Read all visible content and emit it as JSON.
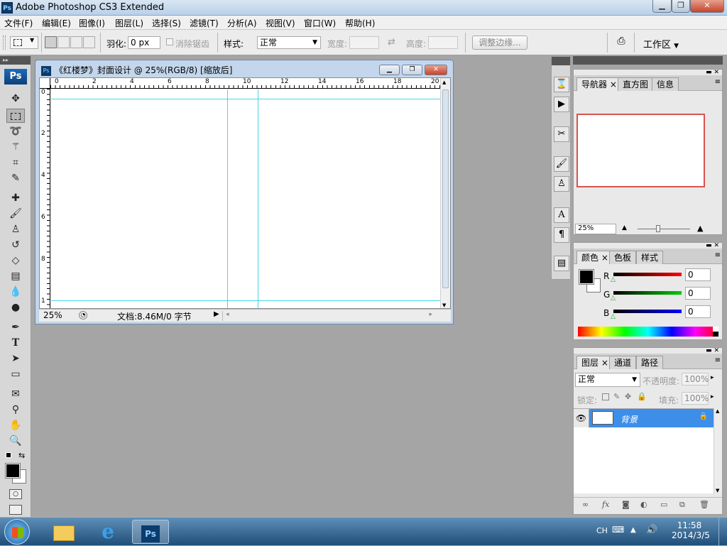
{
  "window": {
    "title": "Adobe Photoshop CS3 Extended",
    "badge": "Ps",
    "min": "▁",
    "max": "❐",
    "close": "✕"
  },
  "menu": [
    "文件(F)",
    "编辑(E)",
    "图像(I)",
    "图层(L)",
    "选择(S)",
    "滤镜(T)",
    "分析(A)",
    "视图(V)",
    "窗口(W)",
    "帮助(H)"
  ],
  "options": {
    "feather_label": "羽化:",
    "feather_value": "0 px",
    "antialias_label": "消除锯齿",
    "style_label": "样式:",
    "style_value": "正常",
    "width_label": "宽度:",
    "height_label": "高度:",
    "refine_edge": "调整边缘...",
    "workspace": "工作区"
  },
  "toolbox": {
    "logo": "Ps"
  },
  "document": {
    "title": "《红楼梦》封面设计 @ 25%(RGB/8) [缩放后]",
    "zoom": "25%",
    "doc_info": "文档:8.46M/0 字节",
    "h_ruler": [
      "0",
      "2",
      "4",
      "6",
      "8",
      "10",
      "12",
      "14",
      "16",
      "18",
      "20"
    ],
    "v_ruler": [
      "0",
      "2",
      "4",
      "6",
      "8",
      "1"
    ]
  },
  "navigator": {
    "tabs": [
      "导航器",
      "直方图",
      "信息"
    ],
    "zoom": "25%"
  },
  "color": {
    "tabs": [
      "颜色",
      "色板",
      "样式"
    ],
    "r_label": "R",
    "g_label": "G",
    "b_label": "B",
    "r": "0",
    "g": "0",
    "b": "0"
  },
  "layers": {
    "tabs": [
      "图层",
      "通道",
      "路径"
    ],
    "blend_mode": "正常",
    "opacity_label": "不透明度:",
    "opacity": "100%",
    "lock_label": "锁定:",
    "fill_label": "填充:",
    "fill": "100%",
    "layer_name": "背景"
  },
  "taskbar": {
    "time": "11:58",
    "date": "2014/3/5",
    "lang": "CH"
  }
}
